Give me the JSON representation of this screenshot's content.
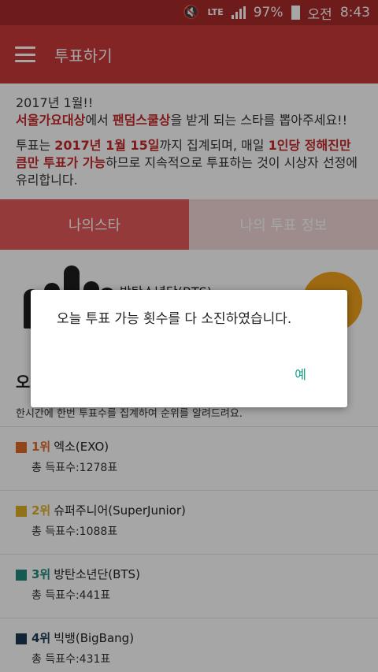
{
  "status_bar": {
    "network": "LTE",
    "battery": "97%",
    "ampm": "오전",
    "time": "8:43",
    "icons": [
      "mute-icon",
      "lte-icon",
      "signal-icon",
      "battery-icon"
    ]
  },
  "app_bar": {
    "menu_icon": "hamburger-icon",
    "title": "투표하기"
  },
  "notice": {
    "line1": "2017년 1월!!",
    "line2_hl1": "서울가요대상",
    "line2_mid": "에서 ",
    "line2_hl2": "팬덤스쿨상",
    "line2_end": "을 받게 되는 스타를 뽑아주세요!!",
    "p2_start": "투표는 ",
    "p2_hl1": "2017년 1월 15일",
    "p2_mid1": "까지 집계되며, 매일 ",
    "p2_hl2": "1인당 정해진만큼만 투표가 가능",
    "p2_end": "하므로 지속적으로 투표하는 것이 시상자 선정에 유리합니다."
  },
  "tabs": [
    {
      "label": "나의스타"
    },
    {
      "label": "나의 투표 정보"
    }
  ],
  "star_card": {
    "group_name": "방탄소년단(BTS)"
  },
  "ranking": {
    "title": "오",
    "desc": "한시간에 한번 투표수를 집계하여 순위를 알려드려요.",
    "items": [
      {
        "rank": "1위",
        "name": "엑소(EXO)",
        "votes": "총 득표수:1278표",
        "color": "#e06a2a"
      },
      {
        "rank": "2위",
        "name": "슈퍼주니어(SuperJunior)",
        "votes": "총 득표수:1088표",
        "color": "#e0ae2a"
      },
      {
        "rank": "3위",
        "name": "방탄소년단(BTS)",
        "votes": "총 득표수:441표",
        "color": "#1f8a80"
      },
      {
        "rank": "4위",
        "name": "빅뱅(BigBang)",
        "votes": "총 득표수:431표",
        "color": "#1d3a55"
      }
    ]
  },
  "dialog": {
    "message": "오늘 투표 가능 횟수를 다 소진하였습니다.",
    "ok_label": "예"
  }
}
